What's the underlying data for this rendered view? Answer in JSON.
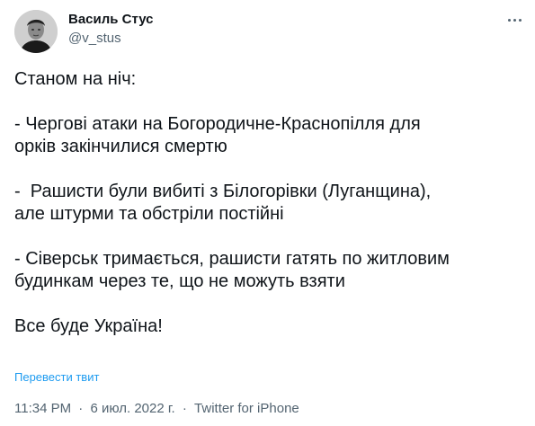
{
  "author": {
    "display_name": "Василь Стус",
    "handle": "@v_stus"
  },
  "tweet": {
    "lines": [
      "Станом на ніч:",
      "",
      "- Чергові атаки на Богородичне-Краснопілля для",
      "орків закінчилися смертю",
      "",
      "-  Рашисти були вибиті з Білогорівки (Луганщина),",
      "але штурми та обстріли постійні",
      "",
      "- Сіверськ тримається, рашисти гатять по житловим",
      "будинкам через те, що не можуть взяти",
      "",
      "Все буде Україна!"
    ],
    "translate_label": "Перевести твит"
  },
  "meta": {
    "time": "11:34 PM",
    "date": "6 июл. 2022 г.",
    "source": "Twitter for iPhone",
    "separator": "·"
  },
  "icons": {
    "more": "more-horizontal-icon",
    "avatar": "avatar-portrait"
  },
  "colors": {
    "text": "#0f1419",
    "secondary": "#536471",
    "link": "#1d9bf0"
  }
}
